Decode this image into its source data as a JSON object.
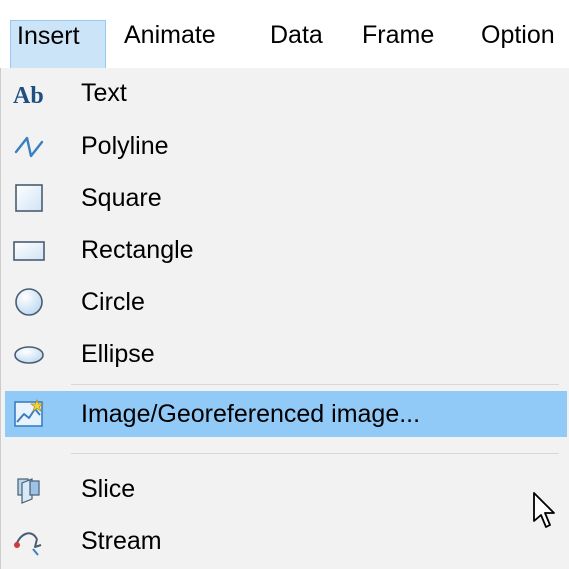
{
  "menubar": {
    "items": [
      {
        "label": "Insert",
        "active": true
      },
      {
        "label": "Animate"
      },
      {
        "label": "Data"
      },
      {
        "label": "Frame"
      },
      {
        "label": "Option"
      }
    ]
  },
  "insert_menu": {
    "items": [
      {
        "label": "Text",
        "icon": "text-ab-icon"
      },
      {
        "label": "Polyline",
        "icon": "polyline-icon"
      },
      {
        "label": "Square",
        "icon": "square-icon"
      },
      {
        "label": "Rectangle",
        "icon": "rectangle-icon"
      },
      {
        "label": "Circle",
        "icon": "circle-icon"
      },
      {
        "label": "Ellipse",
        "icon": "ellipse-icon"
      },
      {
        "label": "Image/Georeferenced image...",
        "icon": "image-icon",
        "highlighted": true
      },
      {
        "label": "Slice",
        "icon": "slice-icon"
      },
      {
        "label": "Stream",
        "icon": "stream-icon"
      }
    ]
  },
  "colors": {
    "menubar_active_bg": "#cce4f7",
    "highlight_bg": "#91c9f7",
    "menu_bg": "#f2f2f2",
    "separator": "#d7d7d7",
    "icon_blue": "#3a7fc1"
  }
}
